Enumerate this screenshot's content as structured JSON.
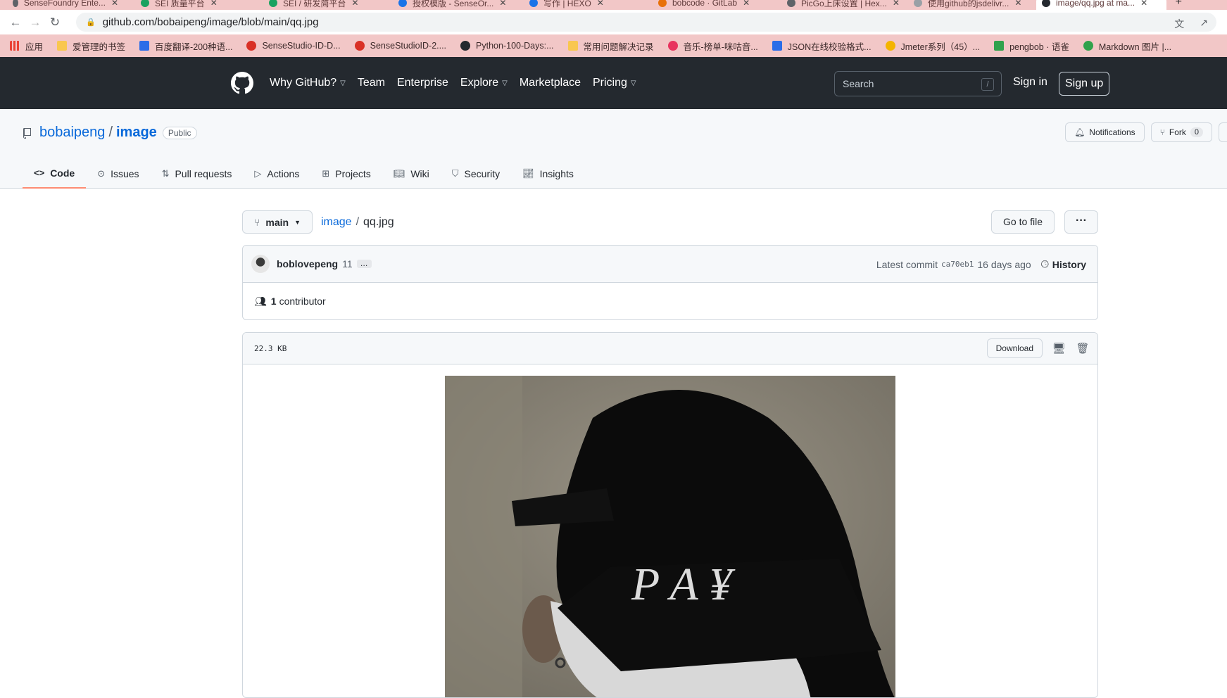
{
  "browser": {
    "tabs": [
      {
        "label": "SenseFoundry Ente...",
        "color": "#5f6368"
      },
      {
        "label": "SEI 质量平台",
        "color": "#1aa260"
      },
      {
        "label": "SEI / 研发简平台",
        "color": "#1aa260"
      },
      {
        "label": "授权模版 - SenseOr...",
        "color": "#1a73e8"
      },
      {
        "label": "写作 | HEXO",
        "color": "#1a73e8"
      },
      {
        "label": "bobcode · GitLab",
        "color": "#e8710a"
      },
      {
        "label": "PicGo上床设置 | Hex...",
        "color": "#5f6368"
      },
      {
        "label": "使用github的jsdelivr...",
        "color": "#9aa0a6"
      },
      {
        "label": "image/qq.jpg at ma...",
        "color": "#24292f"
      }
    ],
    "url": "github.com/bobaipeng/image/blob/main/qq.jpg",
    "bookmarks": [
      {
        "label": "应用",
        "color": "#ea4335"
      },
      {
        "label": "爱管理的书签",
        "color": "#f9c74f"
      },
      {
        "label": "百度翻译-200种语...",
        "color": "#2b6de8"
      },
      {
        "label": "SenseStudio-ID-D...",
        "color": "#d93025"
      },
      {
        "label": "SenseStudioID-2....",
        "color": "#d93025"
      },
      {
        "label": "Python-100-Days:...",
        "color": "#24292f"
      },
      {
        "label": "常用问题解决记录",
        "color": "#f9c74f"
      },
      {
        "label": "音乐-榜单-咪咕音...",
        "color": "#e8335e"
      },
      {
        "label": "JSON在线校验格式...",
        "color": "#2b6de8"
      },
      {
        "label": "Jmeter系列（45）...",
        "color": "#f4b400"
      },
      {
        "label": "pengbob · 语雀",
        "color": "#31a24c"
      },
      {
        "label": "Markdown 图片 |...",
        "color": "#31a24c"
      }
    ]
  },
  "header": {
    "nav": [
      "Why GitHub?",
      "Team",
      "Enterprise",
      "Explore",
      "Marketplace",
      "Pricing"
    ],
    "search_placeholder": "Search",
    "search_shortcut": "/",
    "sign_in": "Sign in",
    "sign_up": "Sign up"
  },
  "repo": {
    "owner": "bobaipeng",
    "separator": "/",
    "name": "image",
    "visibility": "Public",
    "notifications": "Notifications",
    "fork": "Fork",
    "fork_count": "0",
    "tabs": [
      "Code",
      "Issues",
      "Pull requests",
      "Actions",
      "Projects",
      "Wiki",
      "Security",
      "Insights"
    ]
  },
  "file": {
    "branch": "main",
    "crumb_repo": "image",
    "crumb_sep": "/",
    "filename": "qq.jpg",
    "go_to_file": "Go to file",
    "more": "···",
    "commit_user": "boblovepeng",
    "commit_msg": "11",
    "commit_ellipsis": "…",
    "latest_commit_label": "Latest commit",
    "sha": "ca70eb1",
    "commit_time": "16 days ago",
    "history": "History",
    "contributor_count": "1",
    "contributor_label": "contributor",
    "size": "22.3 KB",
    "download": "Download",
    "cap_text": "P A ¥"
  }
}
